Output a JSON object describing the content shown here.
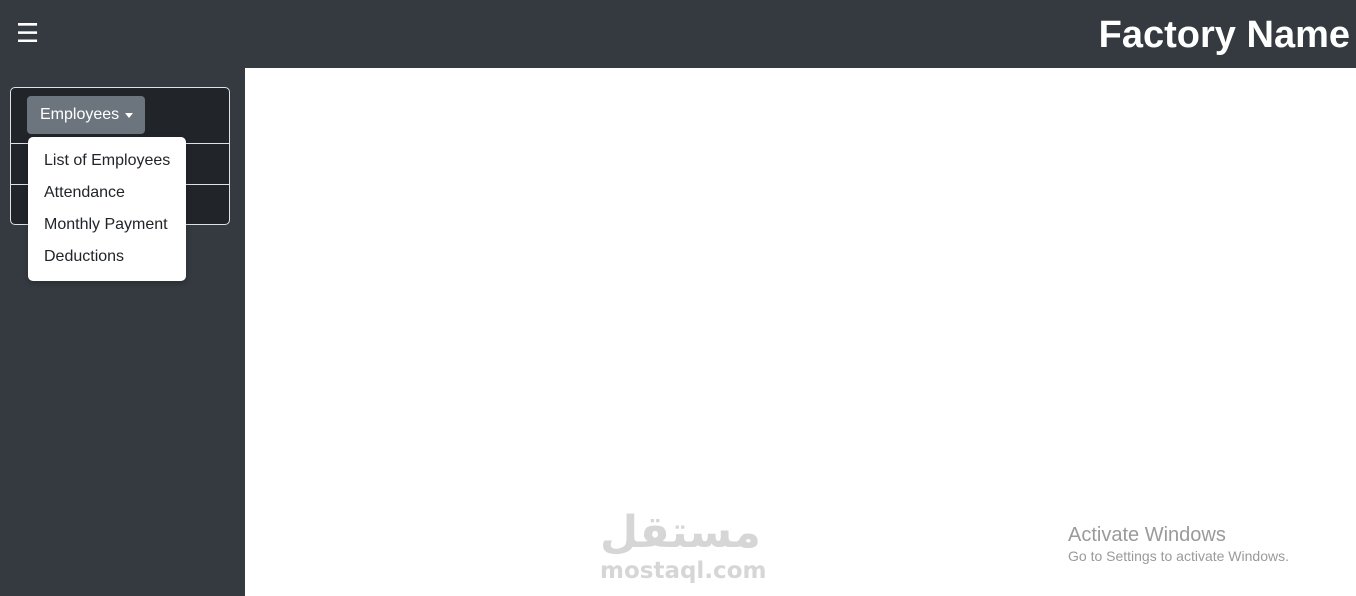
{
  "header": {
    "menu_icon": "hamburger-icon",
    "menu_glyph": "☰",
    "title": "Factory Name"
  },
  "sidebar": {
    "dropdown_label": "Employees",
    "dropdown_icon": "caret-down-icon",
    "menu_items": [
      {
        "label": "List of Employees"
      },
      {
        "label": "Attendance"
      },
      {
        "label": "Monthly Payment"
      },
      {
        "label": "Deductions"
      }
    ]
  },
  "watermark": {
    "arabic": "مستقل",
    "latin": "mostaql.com"
  },
  "os_notice": {
    "title": "Activate Windows",
    "subtitle": "Go to Settings to activate Windows."
  },
  "colors": {
    "navbar": "#343a40",
    "sidebar_card": "#212529",
    "dropdown_button": "#6c757d",
    "content": "#ffffff"
  }
}
